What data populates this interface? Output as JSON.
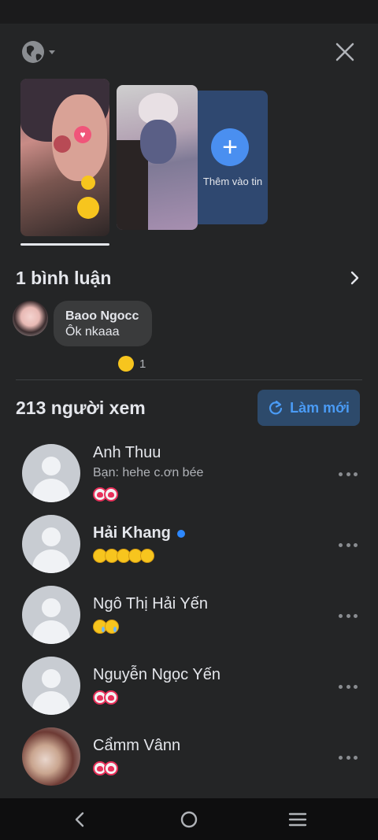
{
  "header": {
    "privacy_icon": "globe-icon",
    "close_icon": "close-icon"
  },
  "stories": {
    "add_label": "Thêm vào tin"
  },
  "comments": {
    "title": "1 bình luận",
    "items": [
      {
        "name": "Baoo Ngocc",
        "text": "Ôk nkaaa",
        "reaction_count": "1"
      }
    ]
  },
  "viewers": {
    "title": "213 người xem",
    "refresh_label": "Làm mới",
    "items": [
      {
        "name": "Anh Thuu",
        "subtitle": "Bạn: hehe c.ơn bée",
        "reactions": "heart x2"
      },
      {
        "name": "Hải Khang",
        "verified": true,
        "reactions": "haha x5"
      },
      {
        "name": "Ngô Thị Hải Yến",
        "reactions": "sad x2"
      },
      {
        "name": "Nguyễn Ngọc Yến",
        "reactions": "heart x2"
      },
      {
        "name": "Cẩmm Vânn",
        "reactions": "heart x2"
      }
    ]
  },
  "colors": {
    "background": "#242526",
    "accent": "#4a9bf5",
    "refresh_bg": "#2d4a6b",
    "add_story_bg": "#2f4870"
  }
}
